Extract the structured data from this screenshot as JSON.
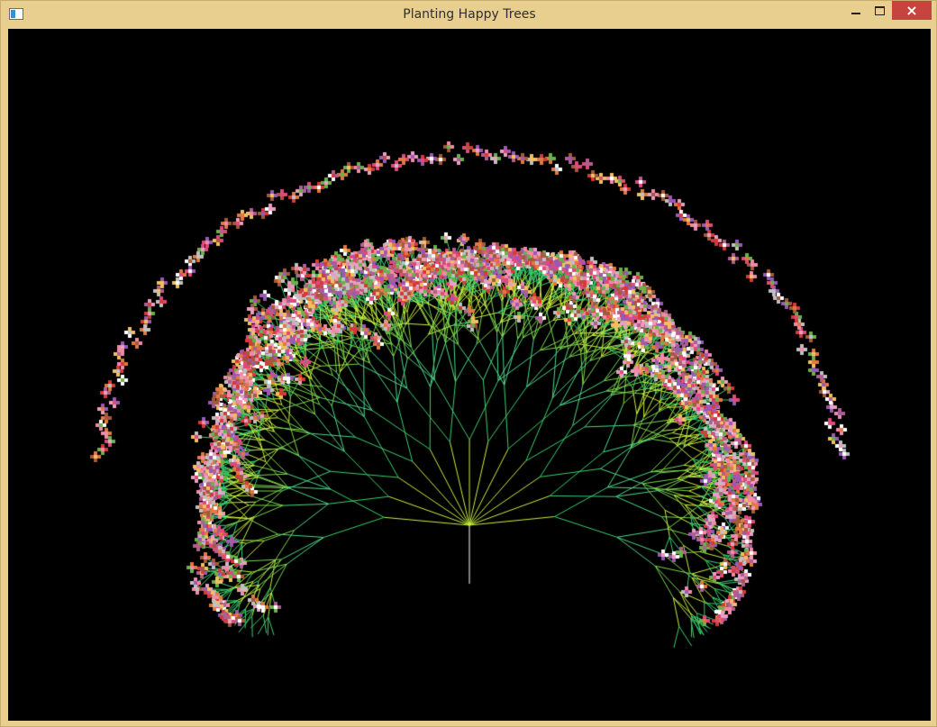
{
  "window": {
    "title": "Planting Happy Trees",
    "controls": {
      "minimize": "minimize-icon",
      "maximize": "maximize-icon",
      "close": "×"
    }
  },
  "scene": {
    "background": "#000000",
    "trunk_color": "#ffffff",
    "branch_colors": [
      "#4dd88a",
      "#7ad64d",
      "#c8f040",
      "#3bcf6e"
    ],
    "blossom_palette": [
      "#e04a7a",
      "#f08aa8",
      "#ffffff",
      "#9b59b6",
      "#e07a40",
      "#d43a3a",
      "#f0c060",
      "#6ab04c",
      "#c0c0c0",
      "#b06090",
      "#e8a0c0",
      "#a35a3a"
    ]
  }
}
